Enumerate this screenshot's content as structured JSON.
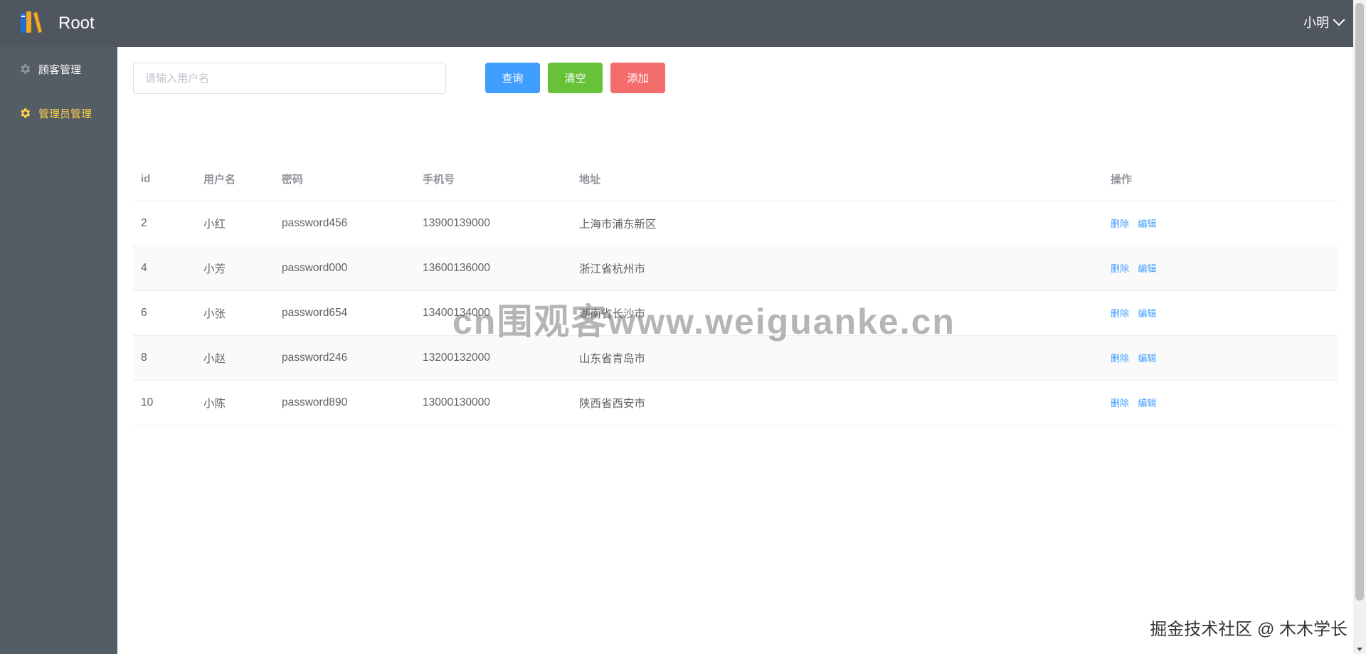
{
  "header": {
    "title": "Root",
    "user_name": "小明",
    "logo_icon": "books-icon",
    "background_color": "#4f565f"
  },
  "sidebar": {
    "items": [
      {
        "label": "顾客管理",
        "icon": "gear-icon",
        "active": false
      },
      {
        "label": "管理员管理",
        "icon": "gear-icon",
        "active": true
      }
    ],
    "active_color": "#ffd04b",
    "background_color": "#545c64"
  },
  "search": {
    "placeholder": "请输入用户名",
    "value": ""
  },
  "buttons": {
    "query": "查询",
    "clear": "清空",
    "add": "添加"
  },
  "table": {
    "columns": [
      "id",
      "用户名",
      "密码",
      "手机号",
      "地址",
      "操作"
    ],
    "rows": [
      {
        "id": "2",
        "username": "小红",
        "password": "password456",
        "phone": "13900139000",
        "address": "上海市浦东新区"
      },
      {
        "id": "4",
        "username": "小芳",
        "password": "password000",
        "phone": "13600136000",
        "address": "浙江省杭州市"
      },
      {
        "id": "6",
        "username": "小张",
        "password": "password654",
        "phone": "13400134000",
        "address": "湖南省长沙市"
      },
      {
        "id": "8",
        "username": "小赵",
        "password": "password246",
        "phone": "13200132000",
        "address": "山东省青岛市"
      },
      {
        "id": "10",
        "username": "小陈",
        "password": "password890",
        "phone": "13000130000",
        "address": "陕西省西安市"
      }
    ],
    "actions": {
      "delete": "删除",
      "edit": "编辑"
    }
  },
  "overlays": {
    "watermark": "cn围观客www.weiguanke.cn",
    "footer": "掘金技术社区 @ 木木学长"
  }
}
